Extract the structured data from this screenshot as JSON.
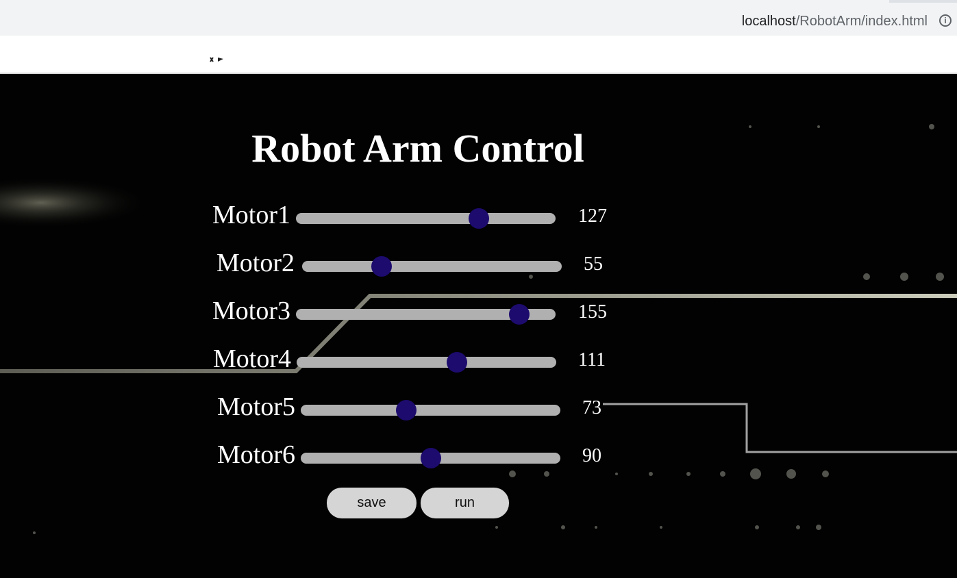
{
  "browser": {
    "url_host": "localhost",
    "url_path": "/RobotArm/index.html",
    "info_icon": "i"
  },
  "page": {
    "title": "Robot Arm Control",
    "motors": [
      {
        "label": "Motor1",
        "value": 127
      },
      {
        "label": "Motor2",
        "value": 55
      },
      {
        "label": "Motor3",
        "value": 155
      },
      {
        "label": "Motor4",
        "value": 111
      },
      {
        "label": "Motor5",
        "value": 73
      },
      {
        "label": "Motor6",
        "value": 90
      }
    ],
    "slider_range": [
      0,
      180
    ],
    "buttons": {
      "save": "save",
      "run": "run"
    }
  },
  "colors": {
    "background": "#020202",
    "track": "#b0b0b0",
    "thumb": "#1d0b6e",
    "button": "#d5d5d5"
  }
}
